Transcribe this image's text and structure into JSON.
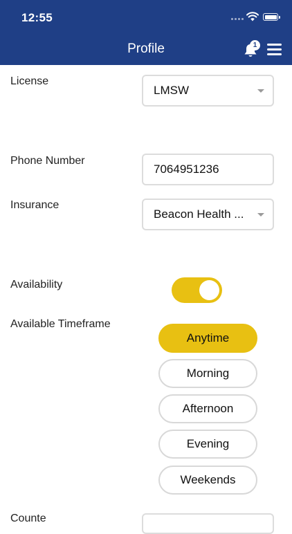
{
  "status_bar": {
    "time": "12:55"
  },
  "header": {
    "title": "Profile",
    "notification_count": "1",
    "bell_icon": "bell-icon",
    "menu_icon": "hamburger-menu-icon"
  },
  "form": {
    "license": {
      "label": "License",
      "value": "LMSW"
    },
    "phone": {
      "label": "Phone Number",
      "value": "7064951236"
    },
    "insurance": {
      "label": "Insurance",
      "value": "Beacon Health ..."
    },
    "availability": {
      "label": "Availability",
      "enabled": true
    },
    "timeframe": {
      "label": "Available Timeframe",
      "options": [
        "Anytime",
        "Morning",
        "Afternoon",
        "Evening",
        "Weekends"
      ],
      "selected": "Anytime"
    },
    "next_label_partial": "Counte"
  },
  "colors": {
    "header_bg": "#1f3f86",
    "accent_yellow": "#e8c012",
    "border_gray": "#dcdcdc"
  }
}
